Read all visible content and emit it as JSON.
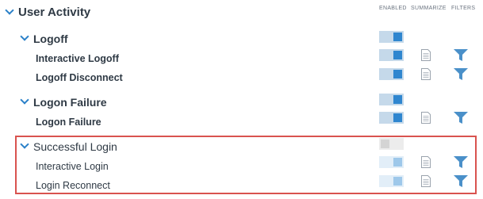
{
  "header": {
    "title": "User Activity",
    "columns": {
      "enabled": "ENABLED",
      "summarize": "SUMMARIZE",
      "filters": "FILTERS"
    }
  },
  "groups": [
    {
      "label": "Logoff",
      "enabled": true,
      "items": [
        {
          "label": "Interactive Logoff",
          "enabled": true
        },
        {
          "label": "Logoff Disconnect",
          "enabled": true
        }
      ]
    },
    {
      "label": "Logon Failure",
      "enabled": true,
      "items": [
        {
          "label": "Logon Failure",
          "enabled": true
        }
      ]
    },
    {
      "label": "Successful Login",
      "enabled": false,
      "highlighted": true,
      "items": [
        {
          "label": "Interactive Login",
          "enabled": true
        },
        {
          "label": "Login Reconnect",
          "enabled": true
        }
      ]
    }
  ],
  "colors": {
    "accent": "#2f86cf",
    "highlight_border": "#d9534f",
    "text": "#2f3a45"
  }
}
